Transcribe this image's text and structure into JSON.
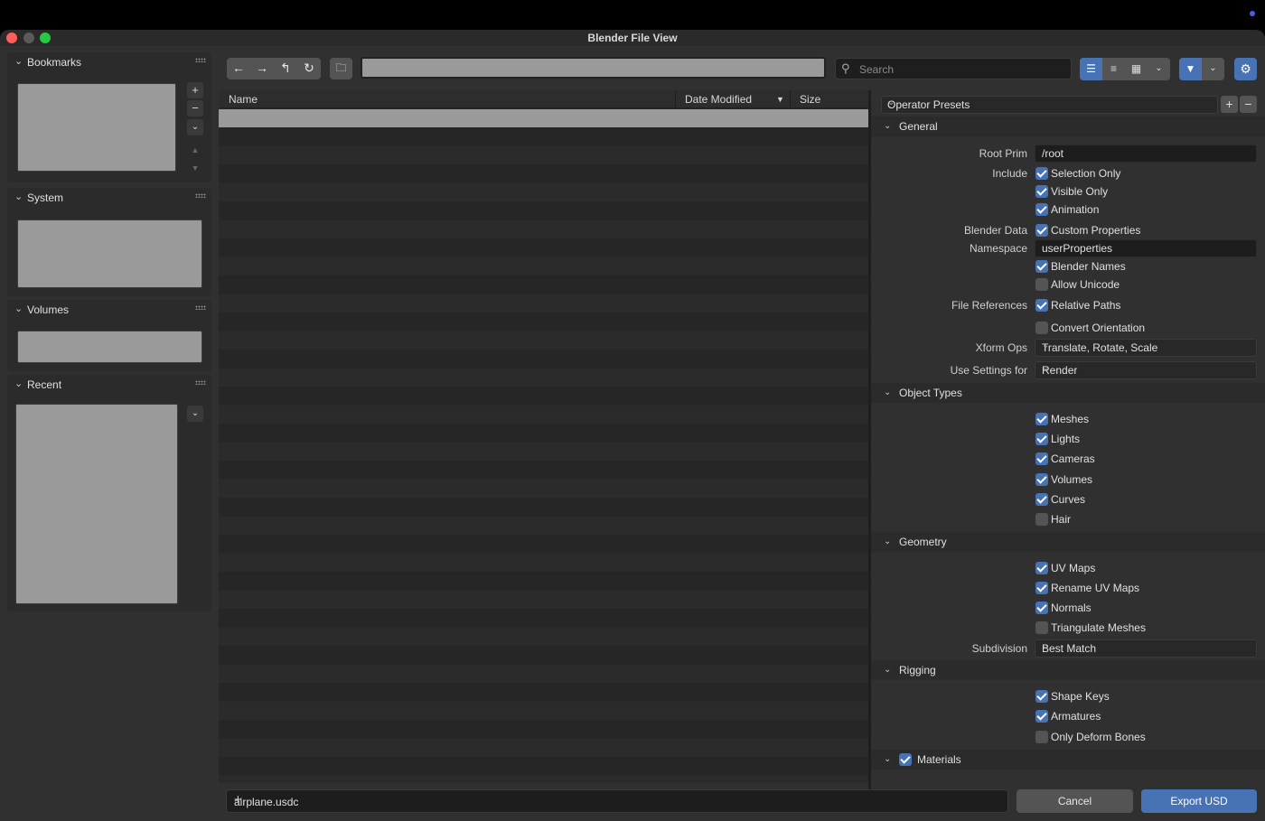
{
  "window": {
    "title": "Blender File View"
  },
  "sidebar": {
    "bookmarks_title": "Bookmarks",
    "system_title": "System",
    "volumes_title": "Volumes",
    "recent_title": "Recent"
  },
  "toolbar": {
    "path_value": "",
    "search_placeholder": "Search"
  },
  "filelist": {
    "col_name": "Name",
    "col_date": "Date Modified",
    "col_size": "Size"
  },
  "props": {
    "preset_label": "Operator Presets",
    "general": {
      "title": "General",
      "root_prim_label": "Root Prim",
      "root_prim_value": "/root",
      "include_label": "Include",
      "selection_only": "Selection Only",
      "visible_only": "Visible Only",
      "animation": "Animation",
      "blender_data_label": "Blender Data",
      "custom_properties": "Custom Properties",
      "namespace_label": "Namespace",
      "namespace_value": "userProperties",
      "blender_names": "Blender Names",
      "allow_unicode": "Allow Unicode",
      "file_refs_label": "File References",
      "relative_paths": "Relative Paths",
      "convert_orientation": "Convert Orientation",
      "xform_ops_label": "Xform Ops",
      "xform_ops_value": "Translate, Rotate, Scale",
      "use_settings_label": "Use Settings for",
      "use_settings_value": "Render"
    },
    "object_types": {
      "title": "Object Types",
      "meshes": "Meshes",
      "lights": "Lights",
      "cameras": "Cameras",
      "volumes": "Volumes",
      "curves": "Curves",
      "hair": "Hair"
    },
    "geometry": {
      "title": "Geometry",
      "uv_maps": "UV Maps",
      "rename_uv_maps": "Rename UV Maps",
      "normals": "Normals",
      "triangulate": "Triangulate Meshes",
      "subdivision_label": "Subdivision",
      "subdivision_value": "Best Match"
    },
    "rigging": {
      "title": "Rigging",
      "shape_keys": "Shape Keys",
      "armatures": "Armatures",
      "only_deform": "Only Deform Bones"
    },
    "materials": {
      "title": "Materials"
    }
  },
  "bottom": {
    "filename": "airplane.usdc",
    "cancel": "Cancel",
    "export": "Export USD"
  },
  "colors": {
    "accent": "#4772b3"
  }
}
